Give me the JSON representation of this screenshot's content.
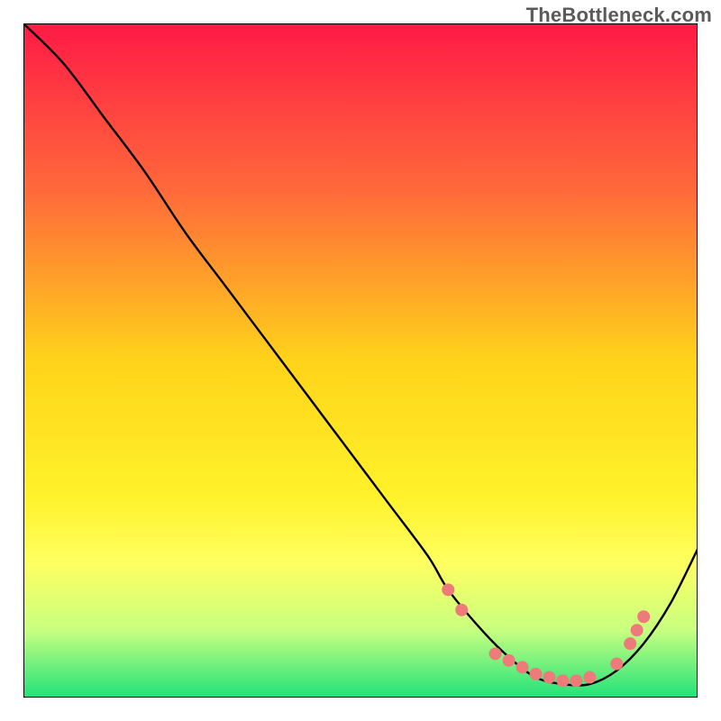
{
  "attribution": "TheBottleneck.com",
  "chart_data": {
    "type": "line",
    "title": "",
    "xlabel": "",
    "ylabel": "",
    "xlim": [
      0,
      100
    ],
    "ylim": [
      0,
      100
    ],
    "background_gradient_stops": [
      {
        "offset": 0,
        "color": "#ff1a46"
      },
      {
        "offset": 25,
        "color": "#ff6a3a"
      },
      {
        "offset": 50,
        "color": "#ffd31a"
      },
      {
        "offset": 70,
        "color": "#fff22a"
      },
      {
        "offset": 80,
        "color": "#ffff60"
      },
      {
        "offset": 90,
        "color": "#c8ff80"
      },
      {
        "offset": 100,
        "color": "#20e27a"
      }
    ],
    "series": [
      {
        "name": "bottleneck-curve",
        "x": [
          0,
          6,
          12,
          18,
          24,
          30,
          36,
          42,
          48,
          54,
          60,
          63,
          68,
          72,
          76,
          80,
          84,
          88,
          92,
          96,
          100
        ],
        "y": [
          100,
          94,
          86,
          78,
          69,
          61,
          53,
          45,
          37,
          29,
          21,
          16,
          10,
          6,
          3,
          2,
          2,
          4,
          8,
          14,
          22
        ],
        "stroke": "#000000",
        "stroke_width": 2.4
      }
    ],
    "markers": {
      "name": "highlight-dots",
      "color": "#ef7a7a",
      "radius": 7,
      "points": [
        {
          "x": 63,
          "y": 16
        },
        {
          "x": 65,
          "y": 13
        },
        {
          "x": 70,
          "y": 6.5
        },
        {
          "x": 72,
          "y": 5.5
        },
        {
          "x": 74,
          "y": 4.5
        },
        {
          "x": 76,
          "y": 3.5
        },
        {
          "x": 78,
          "y": 3
        },
        {
          "x": 80,
          "y": 2.5
        },
        {
          "x": 82,
          "y": 2.5
        },
        {
          "x": 84,
          "y": 3
        },
        {
          "x": 88,
          "y": 5
        },
        {
          "x": 90,
          "y": 8
        },
        {
          "x": 91,
          "y": 10
        },
        {
          "x": 92,
          "y": 12
        }
      ]
    }
  }
}
